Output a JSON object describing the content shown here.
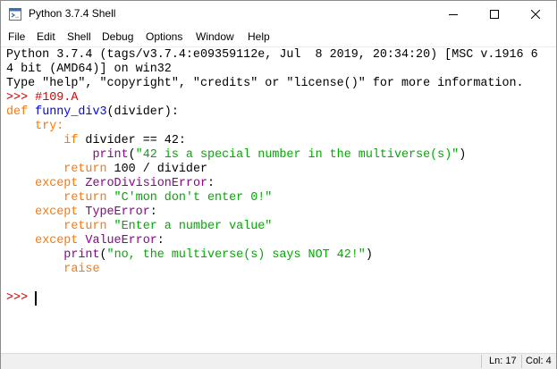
{
  "window": {
    "title": "Python 3.7.4 Shell"
  },
  "menu": [
    "File",
    "Edit",
    "Shell",
    "Debug",
    "Options",
    "Window",
    "Help"
  ],
  "banner": {
    "line1": "Python 3.7.4 (tags/v3.7.4:e09359112e, Jul  8 2019, 20:34:20) [MSC v.1916 6",
    "line2": "4 bit (AMD64)] on win32",
    "line3": "Type \"help\", \"copyright\", \"credits\" or \"license()\" for more information."
  },
  "code": {
    "prompt": ">>> ",
    "comment": "#109.A",
    "def_kw": "def ",
    "func_name": "funny_div3",
    "def_rest": "(divider):",
    "try_kw": "try:",
    "if_kw": "if ",
    "if_rest": "divider == 42:",
    "print_kw": "print",
    "print1_str": "\"42 is a special number in the multiverse(s)\"",
    "paren_open": "(",
    "paren_close": ")",
    "return_kw": "return ",
    "return1_rest": "100 / divider",
    "except_kw": "except ",
    "exc1": "ZeroDivisionError",
    "colon": ":",
    "return2_str": "\"C'mon don't enter 0!\"",
    "exc2": "TypeError",
    "return3_str": "\"Enter a number value\"",
    "exc3": "ValueError",
    "print2_str": "\"no, the multiverse(s) says NOT 42!\"",
    "raise_kw": "raise",
    "prompt2": ">>> "
  },
  "status": {
    "line": "Ln: 17",
    "col": "Col: 4"
  },
  "colors": {
    "keyword": "#ff7700",
    "builtin": "#900090",
    "string": "#00aa00",
    "definition": "#0000ff",
    "prompt": "#c00000"
  },
  "icons": [
    "python-app-icon",
    "minimize-icon",
    "maximize-icon",
    "close-icon"
  ]
}
